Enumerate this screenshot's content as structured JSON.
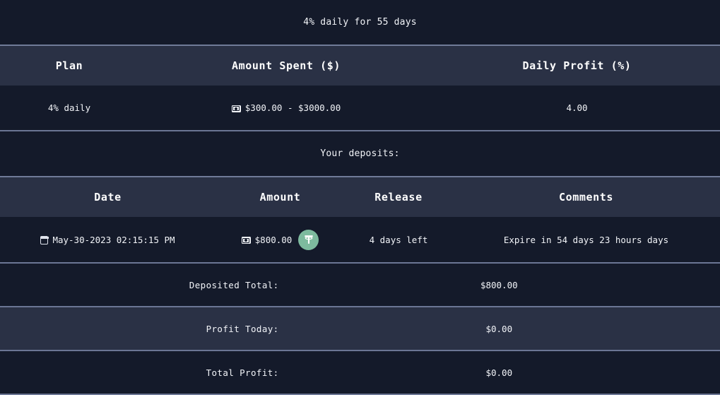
{
  "plan_caption": "4% daily for 55 days",
  "plan_table": {
    "headers": [
      "Plan",
      "Amount Spent ($)",
      "Daily Profit (%)"
    ],
    "rows": [
      {
        "plan": "4% daily",
        "amount_icon": "money-icon",
        "amount_spent": "$300.00 - $3000.00",
        "daily_profit": "4.00"
      }
    ]
  },
  "deposits_caption": "Your deposits:",
  "deposits_table": {
    "headers": [
      "Date",
      "Amount",
      "Release",
      "Comments"
    ],
    "rows": [
      {
        "date_icon": "calendar-icon",
        "date": "May-30-2023 02:15:15 PM",
        "amount_icon": "money-icon",
        "amount": "$800.00",
        "currency_icon": "usdt-icon",
        "currency_symbol": "₮",
        "release": "4 days left",
        "comments": "Expire in 54 days 23 hours days"
      }
    ]
  },
  "summary": [
    {
      "label": "Deposited Total:",
      "value": "$800.00",
      "shade": "dark"
    },
    {
      "label": "Profit Today:",
      "value": "$0.00",
      "shade": "light"
    },
    {
      "label": "Total Profit:",
      "value": "$0.00",
      "shade": "dark"
    }
  ],
  "colors": {
    "page_background": "#141a2a",
    "header_background": "#2a3145",
    "divider": "#6b7694",
    "text": "#f2f4f8",
    "usdt_green": "#7dba9e"
  }
}
